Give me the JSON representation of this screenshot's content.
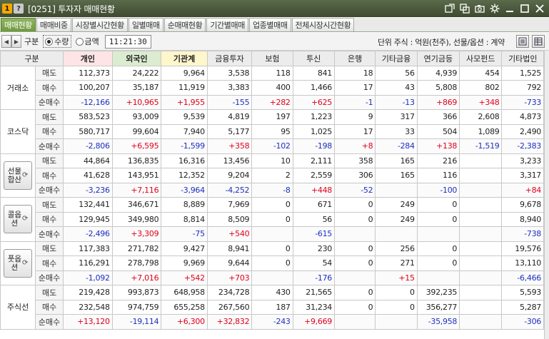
{
  "window": {
    "badge1": "1",
    "badge2": "?",
    "title": "[0251] 투자자 매매현황"
  },
  "tabs": [
    "매매현황",
    "매매비중",
    "시장별시간현황",
    "일별매매",
    "순매매현황",
    "기간별매매",
    "업종별매매",
    "전체시장시간현황"
  ],
  "toolbar": {
    "category_label": "구분",
    "radio_qty": "수량",
    "radio_amount": "금액",
    "time": "11:21:30",
    "unit_text": "단위 주식 : 억원(천주), 선물/옵션 : 계약"
  },
  "columns": [
    "구분",
    "개인",
    "외국인",
    "기관계",
    "금융투자",
    "보험",
    "투신",
    "은행",
    "기타금융",
    "연기금등",
    "사모펀드",
    "기타법인"
  ],
  "row_kinds": [
    "매도",
    "매수",
    "순매수"
  ],
  "groups": [
    {
      "label": "거래소",
      "rows": [
        [
          "112,373",
          "24,222",
          "9,964",
          "3,538",
          "118",
          "841",
          "18",
          "56",
          "4,939",
          "454",
          "1,525"
        ],
        [
          "100,207",
          "35,187",
          "11,919",
          "3,383",
          "400",
          "1,466",
          "17",
          "43",
          "5,808",
          "802",
          "792"
        ],
        [
          "-12,166",
          "+10,965",
          "+1,955",
          "-155",
          "+282",
          "+625",
          "-1",
          "-13",
          "+869",
          "+348",
          "-733"
        ]
      ]
    },
    {
      "label": "코스닥",
      "rows": [
        [
          "583,523",
          "93,009",
          "9,539",
          "4,819",
          "197",
          "1,223",
          "9",
          "317",
          "366",
          "2,608",
          "4,873"
        ],
        [
          "580,717",
          "99,604",
          "7,940",
          "5,177",
          "95",
          "1,025",
          "17",
          "33",
          "504",
          "1,089",
          "2,490"
        ],
        [
          "-2,806",
          "+6,595",
          "-1,599",
          "+358",
          "-102",
          "-198",
          "+8",
          "-284",
          "+138",
          "-1,519",
          "-2,383"
        ]
      ]
    },
    {
      "label": "선물합산",
      "button": true,
      "rows": [
        [
          "44,864",
          "136,835",
          "16,316",
          "13,456",
          "10",
          "2,111",
          "358",
          "165",
          "216",
          "",
          "3,233"
        ],
        [
          "41,628",
          "143,951",
          "12,352",
          "9,204",
          "2",
          "2,559",
          "306",
          "165",
          "116",
          "",
          "3,317"
        ],
        [
          "-3,236",
          "+7,116",
          "-3,964",
          "-4,252",
          "-8",
          "+448",
          "-52",
          "",
          "-100",
          "",
          "+84"
        ]
      ]
    },
    {
      "label": "콜옵션",
      "button": true,
      "rows": [
        [
          "132,441",
          "346,671",
          "8,889",
          "7,969",
          "0",
          "671",
          "0",
          "249",
          "0",
          "",
          "9,678"
        ],
        [
          "129,945",
          "349,980",
          "8,814",
          "8,509",
          "0",
          "56",
          "0",
          "249",
          "0",
          "",
          "8,940"
        ],
        [
          "-2,496",
          "+3,309",
          "-75",
          "+540",
          "",
          "-615",
          "",
          "",
          "",
          "",
          "-738"
        ]
      ]
    },
    {
      "label": "풋옵션",
      "button": true,
      "rows": [
        [
          "117,383",
          "271,782",
          "9,427",
          "8,941",
          "0",
          "230",
          "0",
          "256",
          "0",
          "",
          "19,576"
        ],
        [
          "116,291",
          "278,798",
          "9,969",
          "9,644",
          "0",
          "54",
          "0",
          "271",
          "0",
          "",
          "13,110"
        ],
        [
          "-1,092",
          "+7,016",
          "+542",
          "+703",
          "",
          "-176",
          "",
          "+15",
          "",
          "",
          "-6,466"
        ]
      ]
    },
    {
      "label": "주식선",
      "rows": [
        [
          "219,428",
          "993,873",
          "648,958",
          "234,728",
          "430",
          "21,565",
          "0",
          "0",
          "392,235",
          "",
          "5,593"
        ],
        [
          "232,548",
          "974,759",
          "655,258",
          "267,560",
          "187",
          "31,234",
          "0",
          "0",
          "356,277",
          "",
          "5,287"
        ],
        [
          "+13,120",
          "-19,114",
          "+6,300",
          "+32,832",
          "-243",
          "+9,669",
          "",
          "",
          "-35,958",
          "",
          "-306"
        ]
      ]
    }
  ],
  "colors": {
    "positive": "#e0001b",
    "negative": "#1d2fc0",
    "tab_active": "#7aa64a",
    "titlebar": "#4a573a"
  }
}
